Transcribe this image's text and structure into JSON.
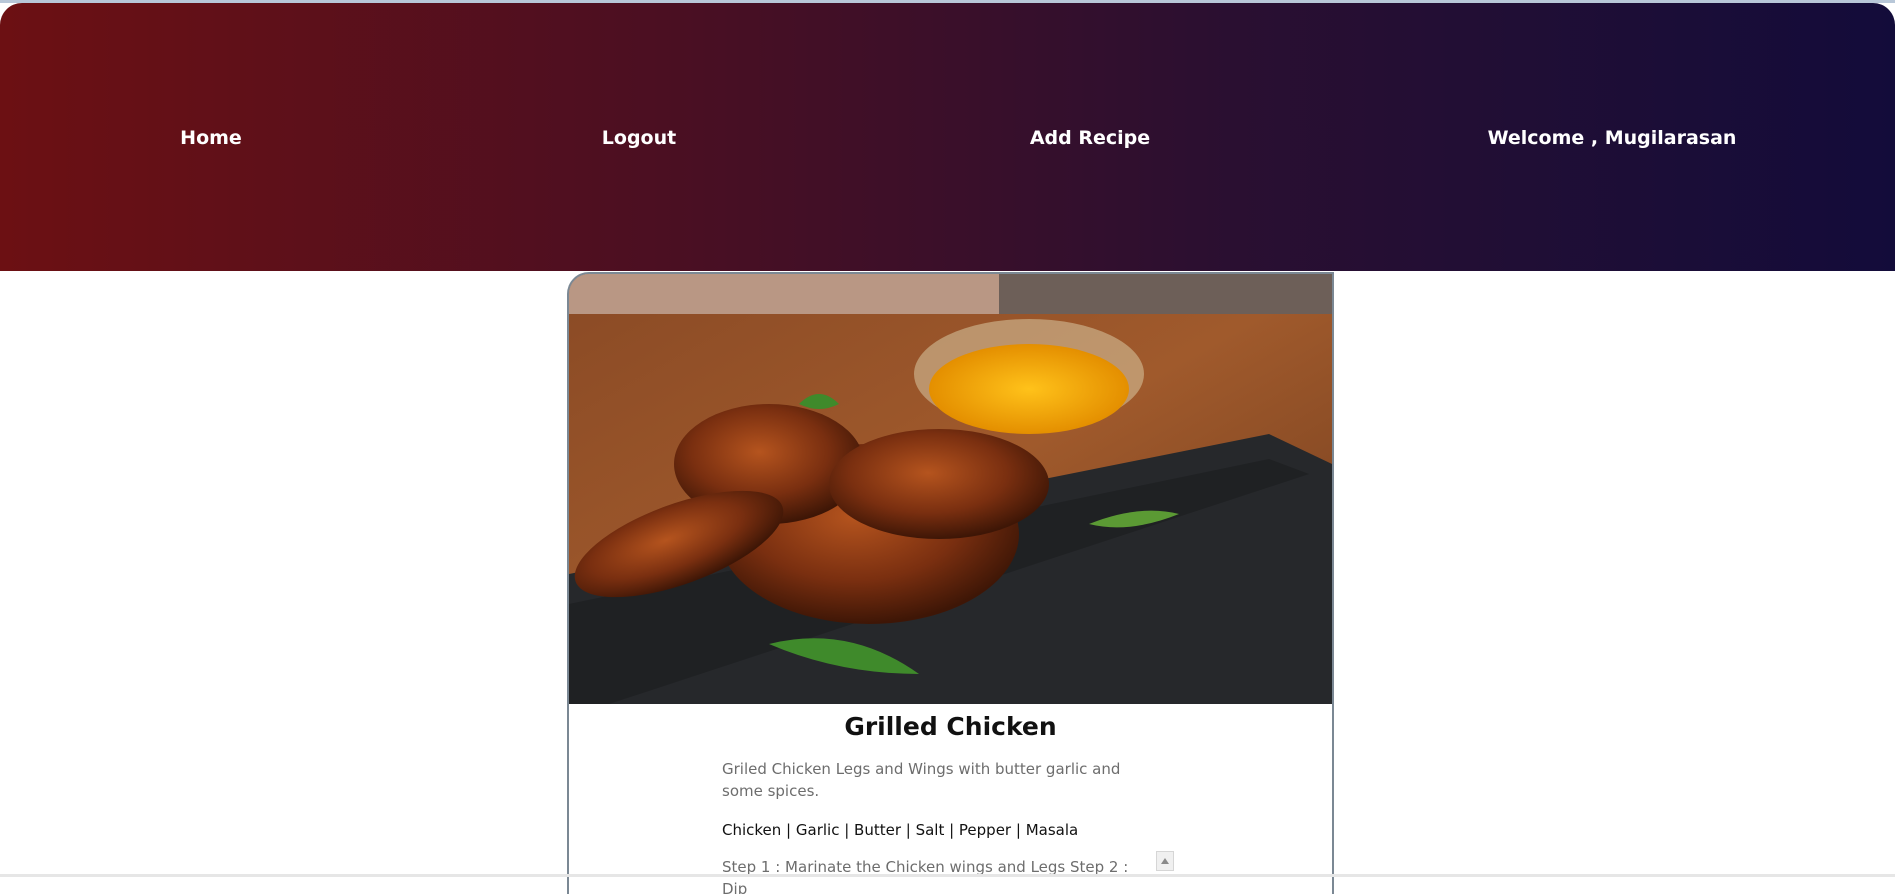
{
  "nav": {
    "home": "Home",
    "logout": "Logout",
    "add_recipe": "Add Recipe",
    "welcome": "Welcome , Mugilarasan"
  },
  "recipe": {
    "title": "Grilled Chicken",
    "description": "Griled Chicken Legs and Wings with butter garlic and some spices.",
    "ingredients": "Chicken | Garlic | Butter | Salt | Pepper | Masala",
    "steps": "Step 1 : Marinate the Chicken wings and Legs Step 2 : Dip"
  },
  "icons": {
    "scroll_up": "scroll-up-arrow-icon"
  },
  "colors": {
    "nav_gradient_start": "#6c1013",
    "nav_gradient_end": "#130c3a"
  }
}
